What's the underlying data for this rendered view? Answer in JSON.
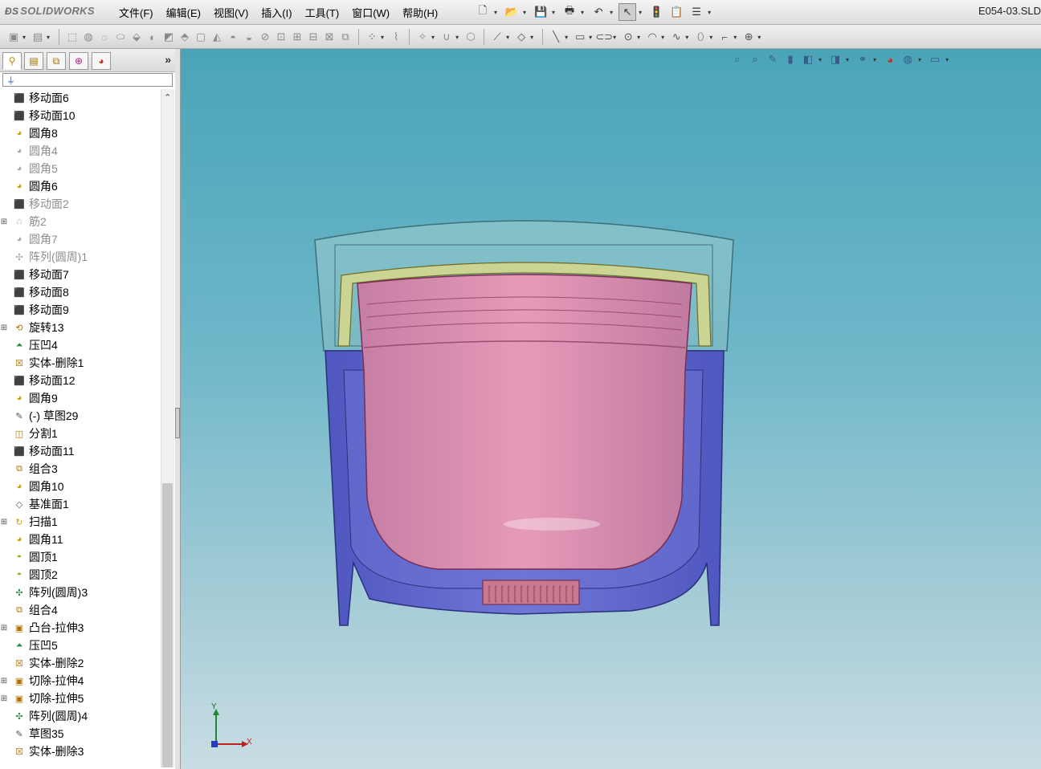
{
  "app": {
    "brand": "SOLIDWORKS",
    "document_title": "E054-03.SLD"
  },
  "menu": [
    "文件(F)",
    "编辑(E)",
    "视图(V)",
    "插入(I)",
    "工具(T)",
    "窗口(W)",
    "帮助(H)"
  ],
  "feature_tree": {
    "items": [
      {
        "label": "移动面6",
        "icon": "move-face-icon",
        "suppressed": false,
        "expandable": false
      },
      {
        "label": "移动面10",
        "icon": "move-face-icon",
        "suppressed": false,
        "expandable": false
      },
      {
        "label": "圆角8",
        "icon": "fillet-icon",
        "suppressed": false,
        "expandable": false
      },
      {
        "label": "圆角4",
        "icon": "fillet-icon",
        "suppressed": true,
        "expandable": false
      },
      {
        "label": "圆角5",
        "icon": "fillet-icon",
        "suppressed": true,
        "expandable": false
      },
      {
        "label": "圆角6",
        "icon": "fillet-icon",
        "suppressed": false,
        "expandable": false
      },
      {
        "label": "移动面2",
        "icon": "move-face-icon",
        "suppressed": true,
        "expandable": false
      },
      {
        "label": "筋2",
        "icon": "rib-icon",
        "suppressed": true,
        "expandable": true
      },
      {
        "label": "圆角7",
        "icon": "fillet-icon",
        "suppressed": true,
        "expandable": false
      },
      {
        "label": "阵列(圆周)1",
        "icon": "circular-pattern-icon",
        "suppressed": true,
        "expandable": false
      },
      {
        "label": "移动面7",
        "icon": "move-face-icon",
        "suppressed": false,
        "expandable": false
      },
      {
        "label": "移动面8",
        "icon": "move-face-icon",
        "suppressed": false,
        "expandable": false
      },
      {
        "label": "移动面9",
        "icon": "move-face-icon",
        "suppressed": false,
        "expandable": false
      },
      {
        "label": "旋转13",
        "icon": "revolve-icon",
        "suppressed": false,
        "expandable": true
      },
      {
        "label": "压凹4",
        "icon": "indent-icon",
        "suppressed": false,
        "expandable": false
      },
      {
        "label": "实体-删除1",
        "icon": "delete-body-icon",
        "suppressed": false,
        "expandable": false
      },
      {
        "label": "移动面12",
        "icon": "move-face-icon",
        "suppressed": false,
        "expandable": false
      },
      {
        "label": "圆角9",
        "icon": "fillet-icon",
        "suppressed": false,
        "expandable": false
      },
      {
        "label": "(-) 草图29",
        "icon": "sketch-icon",
        "suppressed": false,
        "expandable": false
      },
      {
        "label": "分割1",
        "icon": "split-icon",
        "suppressed": false,
        "expandable": false
      },
      {
        "label": "移动面11",
        "icon": "move-face-icon",
        "suppressed": false,
        "expandable": false
      },
      {
        "label": "组合3",
        "icon": "combine-icon",
        "suppressed": false,
        "expandable": false
      },
      {
        "label": "圆角10",
        "icon": "fillet-icon",
        "suppressed": false,
        "expandable": false
      },
      {
        "label": "基准面1",
        "icon": "plane-icon",
        "suppressed": false,
        "expandable": false
      },
      {
        "label": "扫描1",
        "icon": "sweep-icon",
        "suppressed": false,
        "expandable": true
      },
      {
        "label": "圆角11",
        "icon": "fillet-icon",
        "suppressed": false,
        "expandable": false
      },
      {
        "label": "圆顶1",
        "icon": "dome-icon",
        "suppressed": false,
        "expandable": false
      },
      {
        "label": "圆顶2",
        "icon": "dome-icon",
        "suppressed": false,
        "expandable": false
      },
      {
        "label": "阵列(圆周)3",
        "icon": "circular-pattern-icon",
        "suppressed": false,
        "expandable": false
      },
      {
        "label": "组合4",
        "icon": "combine-icon",
        "suppressed": false,
        "expandable": false
      },
      {
        "label": "凸台-拉伸3",
        "icon": "boss-extrude-icon",
        "suppressed": false,
        "expandable": true
      },
      {
        "label": "压凹5",
        "icon": "indent-icon",
        "suppressed": false,
        "expandable": false
      },
      {
        "label": "实体-删除2",
        "icon": "delete-body-icon",
        "suppressed": false,
        "expandable": false
      },
      {
        "label": "切除-拉伸4",
        "icon": "cut-extrude-icon",
        "suppressed": false,
        "expandable": true
      },
      {
        "label": "切除-拉伸5",
        "icon": "cut-extrude-icon",
        "suppressed": false,
        "expandable": true
      },
      {
        "label": "阵列(圆周)4",
        "icon": "circular-pattern-icon",
        "suppressed": false,
        "expandable": false
      },
      {
        "label": "草图35",
        "icon": "sketch-icon",
        "suppressed": false,
        "expandable": false
      },
      {
        "label": "实体-删除3",
        "icon": "delete-body-icon",
        "suppressed": false,
        "expandable": false
      }
    ]
  },
  "triad": {
    "x_label": "X",
    "y_label": "Y"
  },
  "colors": {
    "viewport_top": "#4aa4b8",
    "viewport_bottom": "#c9dde4",
    "outer_shell": "#5b63c8",
    "inner_cup": "#d98aa8",
    "lid": "#a9d3cf",
    "ring": "#d8d88a"
  }
}
